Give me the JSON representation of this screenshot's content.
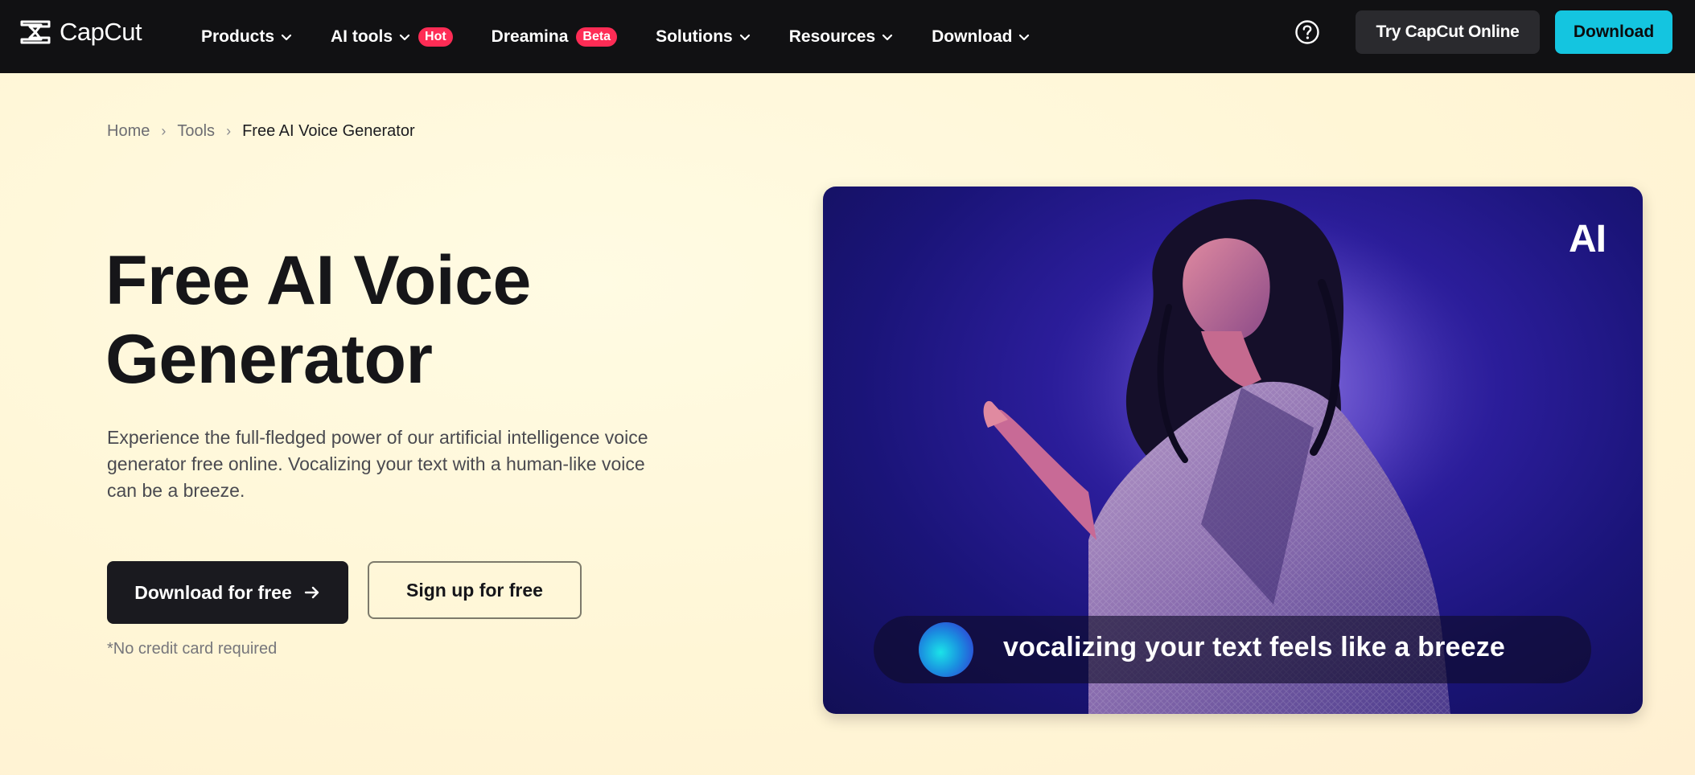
{
  "nav": {
    "logo_text": "CapCut",
    "items": [
      {
        "label": "Products",
        "badge": null
      },
      {
        "label": "AI tools",
        "badge": "Hot"
      },
      {
        "label": "Dreamina",
        "badge": "Beta"
      },
      {
        "label": "Solutions",
        "badge": null
      },
      {
        "label": "Resources",
        "badge": null
      },
      {
        "label": "Download",
        "badge": null
      }
    ],
    "try_online_label": "Try CapCut Online",
    "download_label": "Download",
    "accent_color": "#14c5e0",
    "badge_color": "#fe2c55"
  },
  "breadcrumb": {
    "home": "Home",
    "tools": "Tools",
    "current": "Free AI Voice Generator"
  },
  "hero": {
    "title": "Free AI Voice Generator",
    "description": "Experience the full-fledged power of our artificial intelligence voice generator free online. Vocalizing your text with a human-like voice can be a breeze.",
    "download_free_label": "Download for free",
    "signup_label": "Sign up for free",
    "no_credit_card": "*No credit card required"
  },
  "media": {
    "ai_mark": "AI",
    "caption": "vocalizing your text feels like a breeze"
  }
}
